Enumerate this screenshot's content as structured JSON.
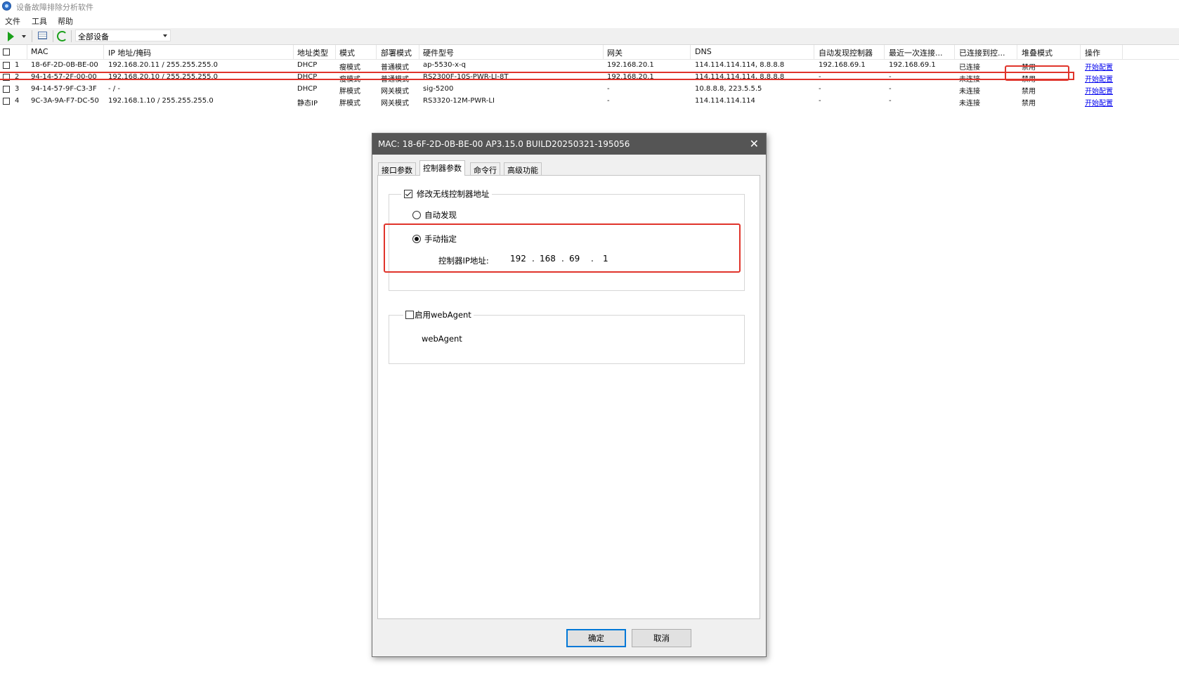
{
  "app": {
    "title": "设备故障排除分析软件"
  },
  "menu": {
    "file": "文件",
    "tools": "工具",
    "help": "帮助"
  },
  "toolbar": {
    "device_filter": "全部设备"
  },
  "table": {
    "columns": [
      "MAC",
      "IP 地址/掩码",
      "地址类型",
      "模式",
      "部署模式",
      "硬件型号",
      "网关",
      "DNS",
      "自动发现控制器",
      "最近一次连接...",
      "已连接到控...",
      "堆叠模式",
      "操作"
    ],
    "rows": [
      {
        "idx": "1",
        "mac": "18-6F-2D-0B-BE-00",
        "ip": "192.168.20.11 / 255.255.255.0",
        "addr_type": "DHCP",
        "mode": "瘦模式",
        "deploy": "普通模式",
        "model": "ap-5530-x-q",
        "gateway": "192.168.20.1",
        "dns": "114.114.114.114, 8.8.8.8",
        "auto_ctrl": "192.168.69.1",
        "last_conn": "192.168.69.1",
        "connected": "已连接",
        "stack": "禁用",
        "action": "开始配置"
      },
      {
        "idx": "2",
        "mac": "94-14-57-2F-00-00",
        "ip": "192.168.20.10 / 255.255.255.0",
        "addr_type": "DHCP",
        "mode": "瘦模式",
        "deploy": "普通模式",
        "model": "RS2300F-10S-PWR-LI-8T",
        "gateway": "192.168.20.1",
        "dns": "114.114.114.114, 8.8.8.8",
        "auto_ctrl": "-",
        "last_conn": "-",
        "connected": "未连接",
        "stack": "禁用",
        "action": "开始配置"
      },
      {
        "idx": "3",
        "mac": "94-14-57-9F-C3-3F",
        "ip": "- / -",
        "addr_type": "DHCP",
        "mode": "胖模式",
        "deploy": "网关模式",
        "model": "sig-5200",
        "gateway": "-",
        "dns": "10.8.8.8, 223.5.5.5",
        "auto_ctrl": "-",
        "last_conn": "-",
        "connected": "未连接",
        "stack": "禁用",
        "action": "开始配置"
      },
      {
        "idx": "4",
        "mac": "9C-3A-9A-F7-DC-50",
        "ip": "192.168.1.10 / 255.255.255.0",
        "addr_type": "静态IP",
        "mode": "胖模式",
        "deploy": "网关模式",
        "model": "RS3320-12M-PWR-LI",
        "gateway": "-",
        "dns": "114.114.114.114",
        "auto_ctrl": "-",
        "last_conn": "-",
        "connected": "未连接",
        "stack": "禁用",
        "action": "开始配置"
      }
    ]
  },
  "dialog": {
    "title": "MAC: 18-6F-2D-0B-BE-00    AP3.15.0 BUILD20250321-195056",
    "close": "✕",
    "tabs": [
      "接口参数",
      "控制器参数",
      "命令行",
      "高级功能"
    ],
    "modify_label": "修改无线控制器地址",
    "modify_checked": true,
    "auto_discover": "自动发现",
    "manual": "手动指定",
    "selected_option": "manual",
    "controller_ip_label": "控制器IP地址:",
    "ip_octets": [
      "192",
      "168",
      "69",
      "1"
    ],
    "ip_dot": ".",
    "webagent_label": "启用webAgent",
    "webagent_checked": false,
    "webagent_text": "webAgent",
    "ok": "确定",
    "cancel": "取消"
  },
  "colors": {
    "highlight": "#e0342b",
    "link": "#0000ee",
    "dialog_title": "#555555",
    "primary_border": "#0078d7"
  }
}
